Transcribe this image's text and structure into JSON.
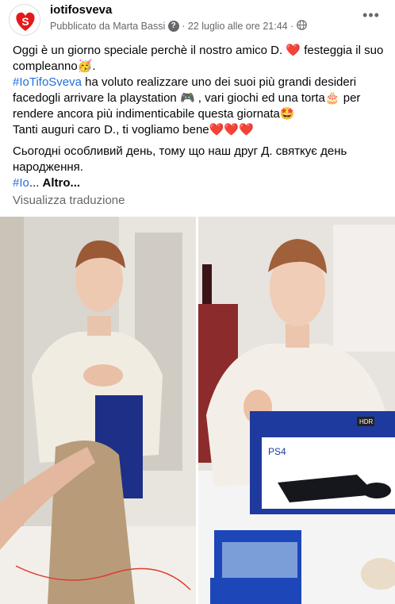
{
  "header": {
    "page_name": "iotifosveva",
    "published_by": "Pubblicato da Marta Bassi",
    "help_icon": "question-circle-icon",
    "separator": "·",
    "timestamp": "22 luglio alle ore 21:44",
    "separator2": "·",
    "audience_icon": "globe-icon",
    "more_icon": "more-horizontal-icon",
    "more_label": "•••"
  },
  "post": {
    "line1": "Oggi è un giorno speciale perchè il nostro amico D.",
    "line1_emoji": "❤️",
    "line1_rest": "festeggia il suo compleanno🥳.",
    "hashtag1": "#IoTifoSveva",
    "line2": "ha voluto realizzare uno dei suoi più grandi desideri facedogli arrivare la playstation 🎮 , vari giochi ed una torta🎂 per rendere ancora più indimenticabile questa giornata🤩",
    "line3": "Tanti auguri caro D., ti vogliamo bene",
    "line3_hearts": "❤️❤️❤️",
    "ukrainian": "Сьогодні особливий день, тому що наш друг Д. святкує день народження.",
    "hashtag2": "#Io",
    "ellipsis": "...",
    "more_link": "Altro..."
  },
  "translate_link": "Visualizza traduzione",
  "photos": {
    "left_alt": "boy-opening-gift-photo",
    "right_alt": "boy-with-ps4-photo",
    "ps4_label": "PS4",
    "hdr_label": "HDR"
  },
  "colors": {
    "brand_red": "#e3191b",
    "link_blue": "#216fdb",
    "meta_gray": "#65676b"
  }
}
